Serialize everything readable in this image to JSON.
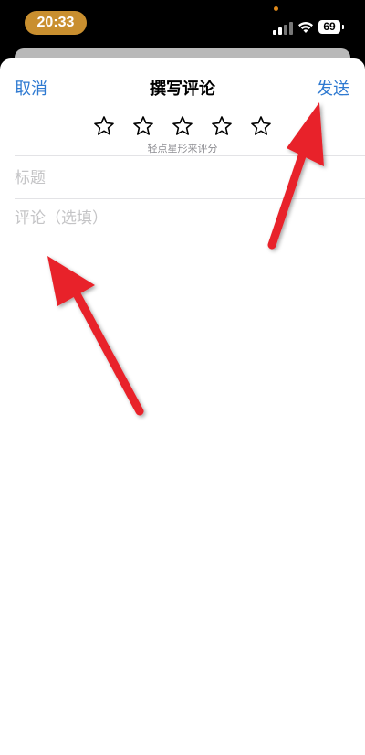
{
  "status_bar": {
    "time": "20:33",
    "battery": "69"
  },
  "nav": {
    "cancel_label": "取消",
    "title": "撰写评论",
    "send_label": "发送"
  },
  "rating": {
    "star_count": 5,
    "hint": "轻点星形来评分"
  },
  "form": {
    "title_placeholder": "标题",
    "review_placeholder": "评论（选填）"
  },
  "colors": {
    "accent": "#2f7ad1",
    "arrow": "#e8232a",
    "time_pill": "#c98f2f"
  },
  "annotations": [
    "red-arrow-to-send-button",
    "red-arrow-to-review-field"
  ]
}
